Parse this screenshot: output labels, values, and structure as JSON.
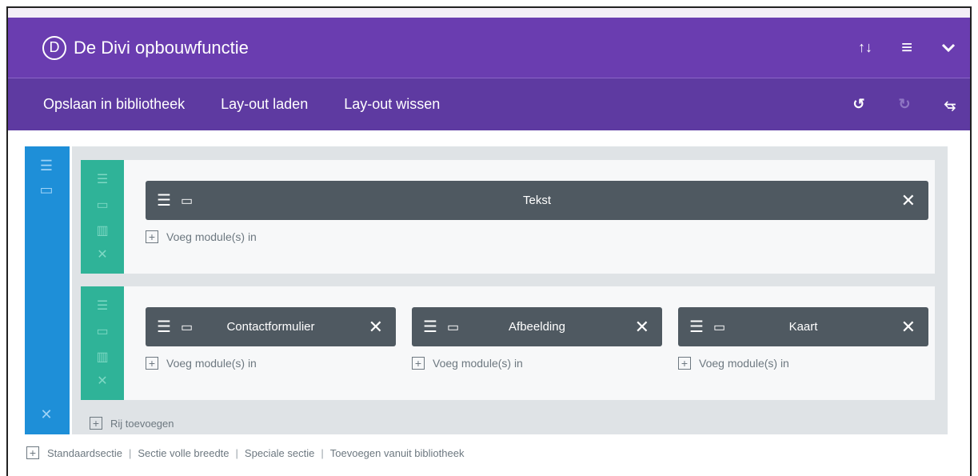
{
  "header": {
    "logo_letter": "D",
    "title": "De Divi opbouwfunctie",
    "icons": [
      "sort-arrows-icon",
      "menu-icon",
      "chevron-down-icon"
    ],
    "sort_glyph": "↑↓",
    "menu_glyph": "≡",
    "chevron_glyph": "⌄"
  },
  "toolbar": {
    "save_library": "Opslaan in bibliotheek",
    "load_layout": "Lay-out laden",
    "clear_layout": "Lay-out wissen",
    "icons": [
      "undo-icon",
      "redo-icon",
      "history-icon"
    ],
    "undo_glyph": "↺",
    "redo_glyph": "↻",
    "history_glyph": "⥃"
  },
  "rows": [
    {
      "modules": [
        {
          "label": "Tekst"
        }
      ],
      "add_module": "Voeg module(s) in"
    },
    {
      "modules": [
        {
          "label": "Contactformulier"
        },
        {
          "label": "Afbeelding"
        },
        {
          "label": "Kaart"
        }
      ],
      "add_module": "Voeg module(s) in"
    }
  ],
  "add_row": "Rij toevoegen",
  "bottom_links": {
    "standard": "Standaardsectie",
    "fullwidth": "Sectie volle breedte",
    "special": "Speciale sectie",
    "from_library": "Toevoegen vanuit bibliotheek",
    "separator": "|"
  },
  "colors": {
    "header": "#6a3db0",
    "toolbar": "#5e3aa1",
    "section": "#1e8fd8",
    "row": "#2fb398",
    "module": "#4f5961"
  }
}
